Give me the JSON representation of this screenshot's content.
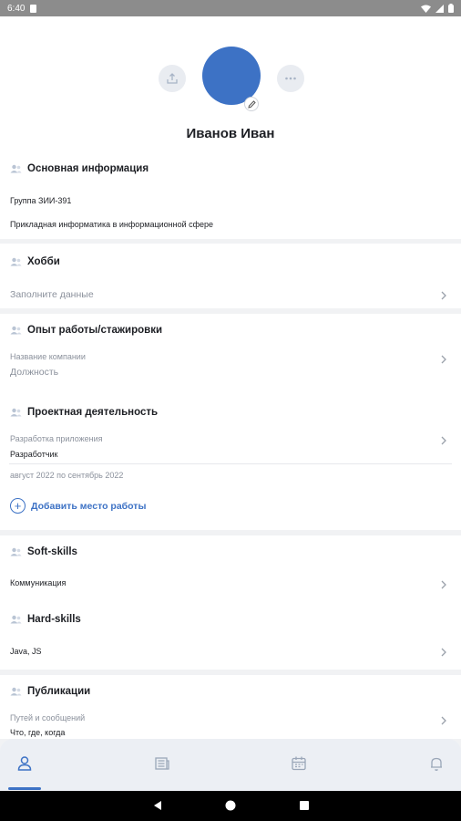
{
  "status_bar": {
    "time": "6:40"
  },
  "profile": {
    "name": "Иванов Иван"
  },
  "basic_info": {
    "title": "Основная информация",
    "group": "Группа ЗИИ-391",
    "program": "Прикладная информатика в информационной сфере"
  },
  "hobby": {
    "title": "Хобби",
    "placeholder": "Заполните данные"
  },
  "work": {
    "title": "Опыт работы/стажировки",
    "company_placeholder": "Название компании",
    "position_placeholder": "Должность"
  },
  "project": {
    "title": "Проектная деятельность",
    "name": "Разработка приложения",
    "role": "Разработчик",
    "period": "август 2022 по сентябрь 2022"
  },
  "add_work_label": "Добавить место работы",
  "soft_skills": {
    "title": "Soft-skills",
    "value": "Коммуникация"
  },
  "hard_skills": {
    "title": "Hard-skills",
    "value": "Java, JS"
  },
  "publications": {
    "title": "Публикации",
    "venue": "Путей и сообщений",
    "name": "Что, где, когда"
  },
  "tabs": [
    "profile-tab",
    "news-tab",
    "calendar-tab",
    "notifications-tab"
  ],
  "colors": {
    "accent": "#3d72c5",
    "text": "#1d1f24",
    "muted": "#8b919c",
    "background": "#f1f2f4"
  }
}
